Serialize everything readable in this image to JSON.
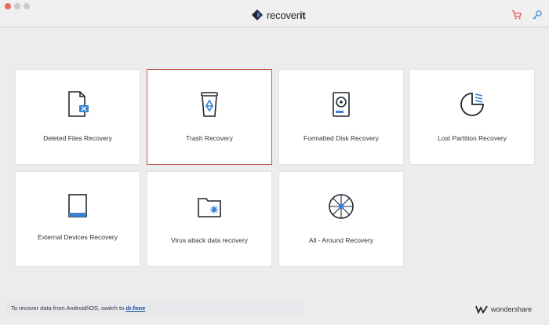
{
  "window": {
    "app_logo_text_a": "recover",
    "app_logo_text_b": "it"
  },
  "cards": [
    {
      "label": "Deleted Files Recovery",
      "icon": "deleted-file-icon"
    },
    {
      "label": "Trash Recovery",
      "icon": "trash-icon",
      "selected": true
    },
    {
      "label": "Formatted Disk Recovery",
      "icon": "disk-icon"
    },
    {
      "label": "Lost Partition Recovery",
      "icon": "partition-icon"
    },
    {
      "label": "External Devices Recovery",
      "icon": "external-device-icon"
    },
    {
      "label": "Virus attack data recovery",
      "icon": "virus-folder-icon"
    },
    {
      "label": "All - Around Recovery",
      "icon": "all-around-icon"
    }
  ],
  "footer": {
    "status_text": "To recover data from Android/iOS, switch to ",
    "link_text": "dr.fone",
    "brand": "wondershare"
  },
  "colors": {
    "selected_border": "#c25a48",
    "accent_red": "#d9534f",
    "accent_blue": "#4a8fd8"
  }
}
